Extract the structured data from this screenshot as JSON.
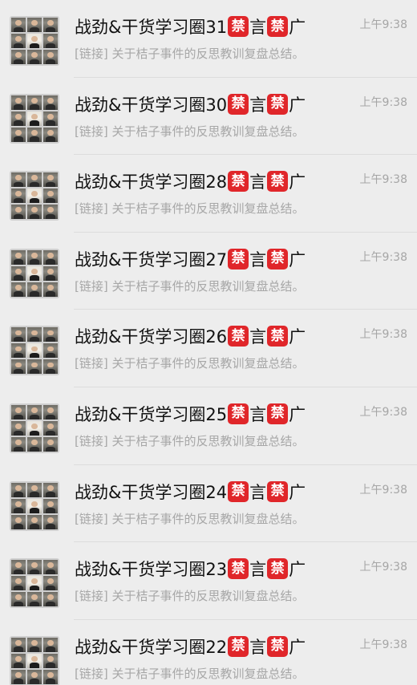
{
  "chats": [
    {
      "title_prefix": "战劲&干货学习圈31",
      "badge": "禁",
      "mid": "言",
      "suffix": "广",
      "time": "上午9:38",
      "preview": "[链接] 关于桔子事件的反思教训复盘总结。"
    },
    {
      "title_prefix": "战劲&干货学习圈30",
      "badge": "禁",
      "mid": "言",
      "suffix": "广",
      "time": "上午9:38",
      "preview": "[链接] 关于桔子事件的反思教训复盘总结。"
    },
    {
      "title_prefix": "战劲&干货学习圈28",
      "badge": "禁",
      "mid": "言",
      "suffix": "广",
      "time": "上午9:38",
      "preview": "[链接] 关于桔子事件的反思教训复盘总结。"
    },
    {
      "title_prefix": "战劲&干货学习圈27",
      "badge": "禁",
      "mid": "言",
      "suffix": "广",
      "time": "上午9:38",
      "preview": "[链接] 关于桔子事件的反思教训复盘总结。"
    },
    {
      "title_prefix": "战劲&干货学习圈26",
      "badge": "禁",
      "mid": "言",
      "suffix": "广",
      "time": "上午9:38",
      "preview": "[链接] 关于桔子事件的反思教训复盘总结。"
    },
    {
      "title_prefix": "战劲&干货学习圈25",
      "badge": "禁",
      "mid": "言",
      "suffix": "广",
      "time": "上午9:38",
      "preview": "[链接] 关于桔子事件的反思教训复盘总结。"
    },
    {
      "title_prefix": "战劲&干货学习圈24",
      "badge": "禁",
      "mid": "言",
      "suffix": "广",
      "time": "上午9:38",
      "preview": "[链接] 关于桔子事件的反思教训复盘总结。"
    },
    {
      "title_prefix": "战劲&干货学习圈23",
      "badge": "禁",
      "mid": "言",
      "suffix": "广",
      "time": "上午9:38",
      "preview": "[链接] 关于桔子事件的反思教训复盘总结。"
    },
    {
      "title_prefix": "战劲&干货学习圈22",
      "badge": "禁",
      "mid": "言",
      "suffix": "广",
      "time": "上午9:38",
      "preview": "[链接] 关于桔子事件的反思教训复盘总结。"
    }
  ],
  "colors": {
    "background": "#ededed",
    "badge": "#e0262a",
    "title": "#111111",
    "secondary": "#a7a7a7"
  },
  "icons": {
    "avatar": "group-avatar-icon",
    "badge": "forbidden-emoji-icon"
  }
}
